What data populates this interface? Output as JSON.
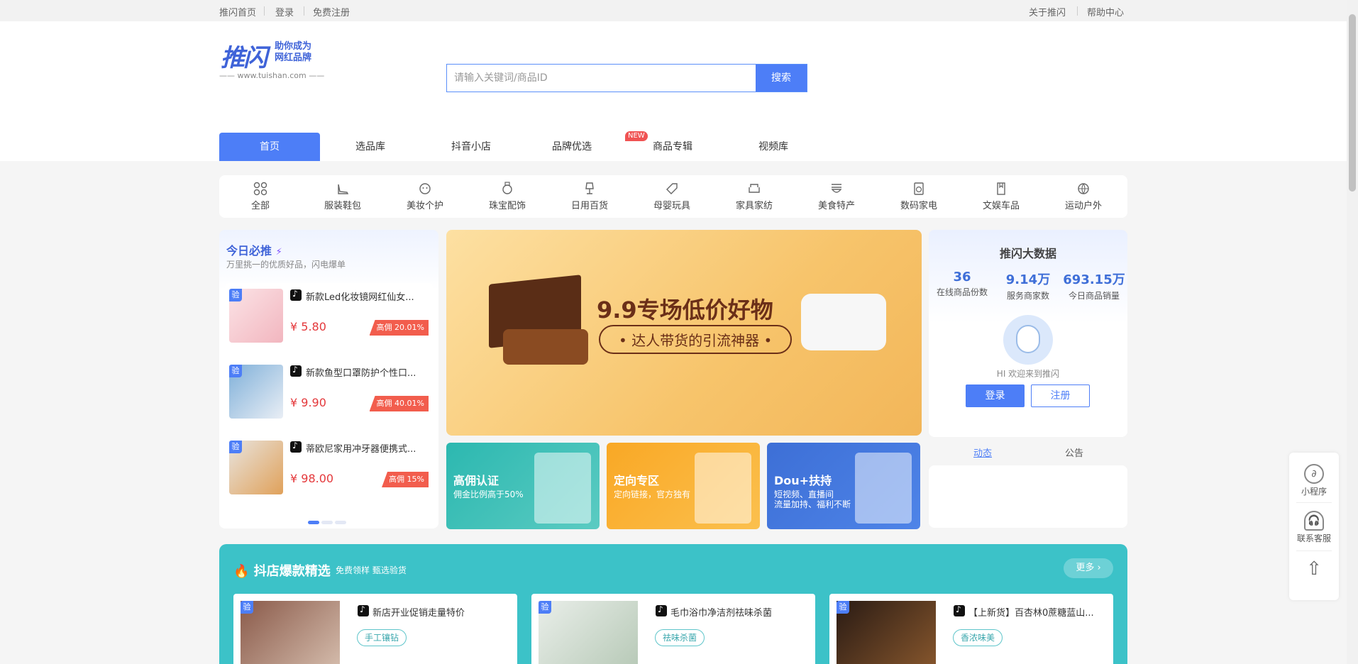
{
  "topbar": {
    "home": "推闪首页",
    "login": "登录",
    "register": "免费注册",
    "about": "关于推闪",
    "help": "帮助中心"
  },
  "logo": {
    "text": "推闪",
    "slogan1": "助你成为",
    "slogan2": "网红品牌",
    "url": "—— www.tuishan.com ——"
  },
  "search": {
    "placeholder": "请输入关键词/商品ID",
    "button": "搜索"
  },
  "nav": {
    "items": [
      "首页",
      "选品库",
      "抖音小店",
      "品牌优选",
      "商品专辑",
      "视频库"
    ],
    "new_badge": "NEW"
  },
  "categories": [
    "全部",
    "服装鞋包",
    "美妆个护",
    "珠宝配饰",
    "日用百货",
    "母婴玩具",
    "家具家纺",
    "美食特产",
    "数码家电",
    "文娱车品",
    "运动户外"
  ],
  "today": {
    "title": "今日必推",
    "subtitle": "万里挑一的优质好品，闪电爆单",
    "badge": "验",
    "items": [
      {
        "title": "新款Led化妆镜网红仙女...",
        "price": "¥ 5.80",
        "commission": "高佣 20.01%"
      },
      {
        "title": "新款鱼型口罩防护个性口...",
        "price": "¥ 9.90",
        "commission": "高佣 40.01%"
      },
      {
        "title": "蒂欧尼家用冲牙器便携式...",
        "price": "¥ 98.00",
        "commission": "高佣 15%"
      }
    ]
  },
  "banner": {
    "headline": "9.9专场低价好物",
    "sub": "• 达人带货的引流神器 •"
  },
  "deals": [
    {
      "title": "高佣认证",
      "sub": "佣金比例高于50%",
      "color": "#2cb8b0"
    },
    {
      "title": "定向专区",
      "sub": "定向链接，官方独有",
      "color": "#f9b03c"
    },
    {
      "title": "Dou+扶持",
      "sub": "短视频、直播间\n流量加持、福利不断",
      "color": "#3d6fd6"
    }
  ],
  "stats": {
    "title": "推闪大数据",
    "items": [
      {
        "value": "36",
        "label": "在线商品份数"
      },
      {
        "value": "9.14万",
        "label": "服务商家数"
      },
      {
        "value": "693.15万",
        "label": "今日商品销量"
      }
    ],
    "welcome": "HI 欢迎来到推闪",
    "login": "登录",
    "register": "注册"
  },
  "info_tabs": {
    "news": "动态",
    "notice": "公告"
  },
  "float": {
    "mini": "小程序",
    "service": "联系客服"
  },
  "hot": {
    "title": "抖店爆款精选",
    "sub": "免费领样  甄选验货",
    "more": "更多 ›",
    "badge": "验",
    "items": [
      {
        "title": "新店开业促销走量特价",
        "tag": "手工镶钻"
      },
      {
        "title": "毛巾浴巾净洁剂祛味杀菌",
        "tag": "祛味杀菌"
      },
      {
        "title": "【上新货】百杏林0蔗糖蓝山...",
        "tag": "香浓味美"
      }
    ]
  },
  "colors": {
    "accent": "#4d7ef7",
    "hot_bg": "#3cc2c8",
    "price": "#e4393c"
  }
}
